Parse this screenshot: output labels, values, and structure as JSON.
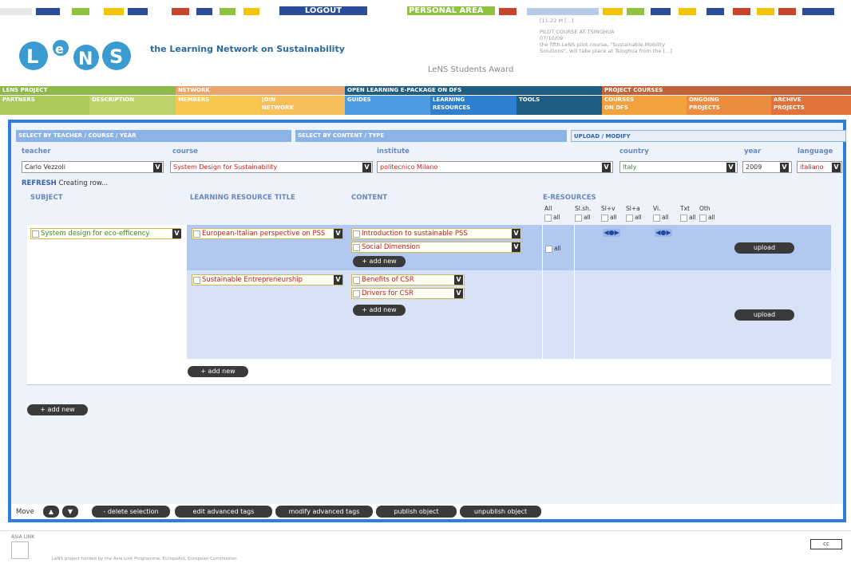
{
  "top": {
    "logout": "LOGOUT",
    "personal_area": "PERSONAL AREA"
  },
  "brand": {
    "logo": "LeNS",
    "tagline": "the Learning Network on Sustainability",
    "award": "LeNS Students Award"
  },
  "news": {
    "date": "[11-22 M [...]",
    "title": "PILOT COURSE AT TSINGHUA",
    "date2": "07/10/09",
    "text": "the fifth LeNS pilot course, \"Sustainable Mobility Solutions\", will take place at Tsinghua from the [...]"
  },
  "nav": {
    "lens_project": "LENS PROJECT",
    "network": "NETWORK",
    "open_learning": "OPEN LEARNING E-PACKAGE ON DFS",
    "project_courses": "PROJECT COURSES",
    "partners": "PARTNERS",
    "description": "DESCRIPTION",
    "members": "MEMBERS",
    "join": "JOIN",
    "network2": "NETWORK",
    "guides": "GUIDES",
    "learning": "LEARNING",
    "resources": "RESOURCES",
    "tools": "TOOLS",
    "courses": "COURSES",
    "on_dfs": "ON DFS",
    "ongoing": "ONGOING",
    "projects": "PROJECTS",
    "archive": "ARCHIVE",
    "projects2": "PROJECTS"
  },
  "select": {
    "by_teacher": "SELECT BY TEACHER / COURSE / YEAR",
    "by_content": "SELECT BY CONTENT / TYPE",
    "upload": "UPLOAD / MODIFY"
  },
  "filters": {
    "teacher_label": "teacher",
    "course_label": "course",
    "institute_label": "institute",
    "country_label": "country",
    "year_label": "year",
    "language_label": "language",
    "teacher": "Carlo Vezzoli",
    "course": "System Design for Sustainability",
    "institute": "politecnico Milano",
    "country": "Italy",
    "year": "2009",
    "language": "italiano",
    "v": "V"
  },
  "status": {
    "refresh": "REFRESH",
    "creating": "Creating row..."
  },
  "cols": {
    "subject": "SUBJECT",
    "title": "LEARNING RESOURCE TITLE",
    "content": "CONTENT",
    "eres": "E-RESOURCES",
    "all": "All",
    "slsh": "Sl.sh.",
    "slv": "Sl+v",
    "sla": "Sl+a",
    "vi": "Vi.",
    "txt": "Txt",
    "oth": "Oth",
    "all_small": "all"
  },
  "rows": {
    "subject": "System design for eco-efficency",
    "title1": "European-Italian perspective on PSS",
    "title2": "Sustainable Entrepreneurship",
    "c1": "Introduction to sustainable PSS",
    "c2": "Social Dimension",
    "c3": "Benefits of CSR",
    "c4": "Drivers for CSR",
    "add_new": "+ add new",
    "upload": "upload",
    "eye": "◀●▶"
  },
  "toolbar": {
    "move": "Move",
    "up": "▲",
    "down": "▼",
    "delete": "- delete selection",
    "edit": "edit advanced tags",
    "modify": "modify advanced tags",
    "publish": "publish object",
    "unpublish": "unpublish object"
  },
  "footer": {
    "asia_link": "ASIA LINK",
    "funded": "LeNS project funded by the Asia Link Programme, EuropeAid, European Commission",
    "cc": "cc"
  }
}
